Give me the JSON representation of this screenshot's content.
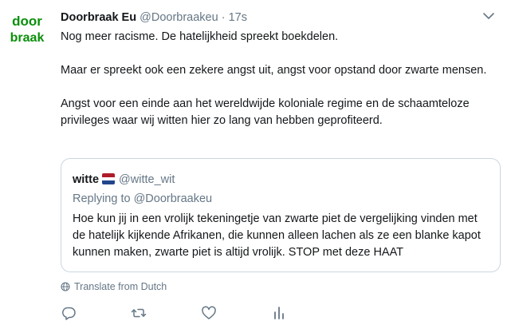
{
  "tweet": {
    "display_name": "Doorbraak Eu",
    "handle": "@Doorbraakeu",
    "dot": "·",
    "time": "17s",
    "avatar_text_top": "door",
    "avatar_text_bottom": "braak",
    "paragraphs": [
      "Nog meer racisme. De hatelijkheid spreekt boekdelen.",
      "Maar er spreekt ook een zekere angst uit, angst voor opstand door zwarte mensen.",
      "Angst voor een einde aan het wereldwijde koloniale regime en de schaamteloze privileges waar wij witten hier zo lang van hebben geprofiteerd."
    ]
  },
  "quote": {
    "display_name": "witte",
    "handle": "@witte_wit",
    "replying_to": "Replying to @Doorbraakeu",
    "text": "Hoe kun jij in een vrolijk tekeningetje van zwarte piet de vergelijking vinden met de hatelijk kijkende Afrikanen, die kunnen alleen lachen als ze een blanke kapot kunnen maken, zwarte piet is altijd vrolijk. STOP met deze HAAT"
  },
  "translate_label": "Translate from Dutch",
  "colors": {
    "avatar_green": "#0a8f0a",
    "muted": "#657786",
    "border": "#ccd6dd",
    "flag_red": "#ae1c28",
    "flag_white": "#ffffff",
    "flag_blue": "#21468b"
  },
  "icons": [
    "caret-down-icon",
    "globe-icon",
    "reply-icon",
    "retweet-icon",
    "like-icon",
    "analytics-icon"
  ]
}
